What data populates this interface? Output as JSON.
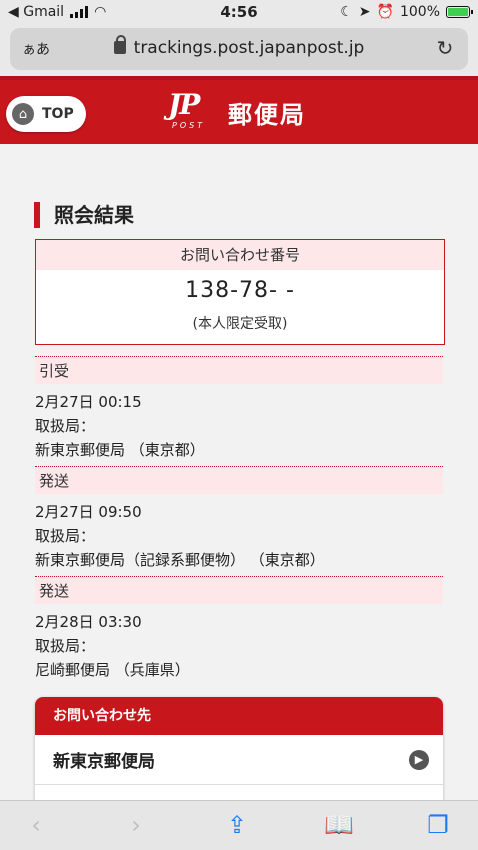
{
  "status_bar": {
    "back_app": "◀ Gmail",
    "time": "4:56",
    "battery_percent": "100%"
  },
  "browser": {
    "aa_label": "ぁあ",
    "url": "trackings.post.japanpost.jp"
  },
  "header": {
    "top_button": "TOP",
    "logo_mark": "JP",
    "logo_post": "POST",
    "brand_name": "郵便局",
    "brand_color": "#c8161d"
  },
  "result": {
    "section_title": "照会結果",
    "inquiry_label": "お問い合わせ番号",
    "tracking_number": "138-78-            -",
    "delivery_note": "(本人限定受取)"
  },
  "events": [
    {
      "status": "引受",
      "datetime": "2月27日 00:15",
      "office_label": "取扱局：",
      "office": "新東京郵便局 （東京都）"
    },
    {
      "status": "発送",
      "datetime": "2月27日 09:50",
      "office_label": "取扱局：",
      "office": "新東京郵便局（記録系郵便物） （東京都）"
    },
    {
      "status": "発送",
      "datetime": "2月28日 03:30",
      "office_label": "取扱局：",
      "office": "尼崎郵便局 （兵庫県）"
    }
  ],
  "contact": {
    "title": "お問い合わせ先",
    "office": "新東京郵便局"
  },
  "toolbar": {
    "icons": [
      "back-icon",
      "forward-icon",
      "share-icon",
      "bookmarks-icon",
      "tabs-icon"
    ]
  }
}
